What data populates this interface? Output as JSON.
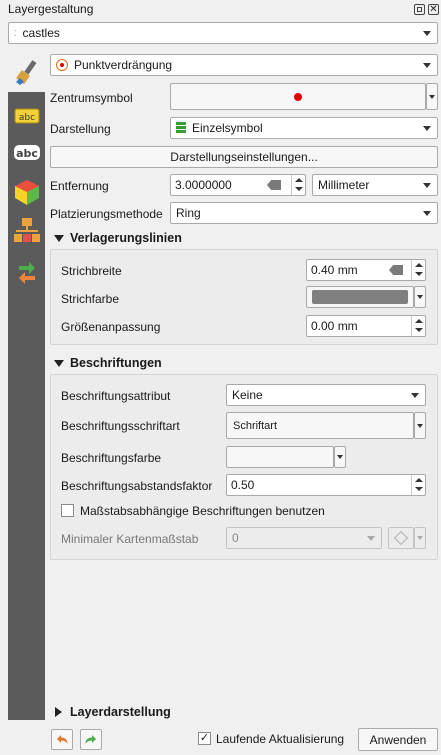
{
  "panel": {
    "title": "Layergestaltung"
  },
  "layer_select": {
    "value": "castles"
  },
  "renderer_select": {
    "value": "Punktverdrängung"
  },
  "form": {
    "center_symbol_label": "Zentrumsymbol",
    "rendering_label": "Darstellung",
    "rendering_value": "Einzelsymbol",
    "render_settings_button": "Darstellungseinstellungen...",
    "distance_label": "Entfernung",
    "distance_value": "3.0000000",
    "distance_unit": "Millimeter",
    "placement_label": "Platzierungsmethode",
    "placement_value": "Ring"
  },
  "lines_section": {
    "title": "Verlagerungslinien",
    "stroke_width_label": "Strichbreite",
    "stroke_width_value": "0.40 mm",
    "stroke_color_label": "Strichfarbe",
    "size_adjust_label": "Größenanpassung",
    "size_adjust_value": "0.00 mm"
  },
  "labels_section": {
    "title": "Beschriftungen",
    "attr_label": "Beschriftungsattribut",
    "attr_value": "Keine",
    "font_label": "Beschriftungsschriftart",
    "font_button": "Schriftart",
    "color_label": "Beschriftungsfarbe",
    "distance_factor_label": "Beschriftungsabstandsfaktor",
    "distance_factor_value": "0.50",
    "scale_checkbox_label": "Maßstabsabhängige Beschriftungen benutzen",
    "min_scale_label": "Minimaler Kartenmaßstab",
    "min_scale_value": "0"
  },
  "layer_rendering_section": {
    "title": "Layerdarstellung"
  },
  "footer": {
    "live_update_label": "Laufende Aktualisierung",
    "apply_button": "Anwenden"
  },
  "colors": {
    "center_symbol": "#e00000",
    "stroke_color": "#808080",
    "sidebar": "#5b5b5b"
  }
}
